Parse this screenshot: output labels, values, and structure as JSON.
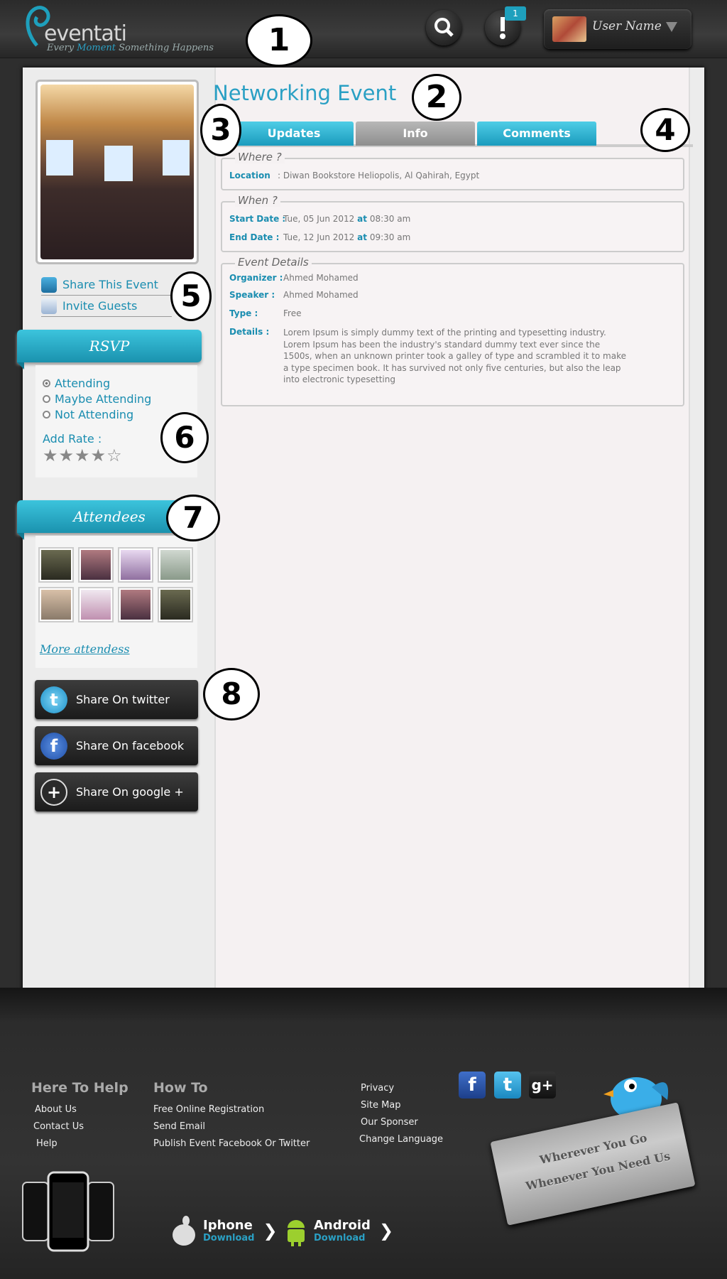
{
  "header": {
    "logo_word": "eventati",
    "tagline_pre": "Every",
    "tagline_hl": "Moment",
    "tagline_post": "Something Happens",
    "notification_count": "1",
    "user_name": "User Name"
  },
  "callouts": [
    "1",
    "2",
    "3",
    "4",
    "5",
    "6",
    "7",
    "8"
  ],
  "event": {
    "title": "Networking Event"
  },
  "tabs": [
    {
      "label": "Updates",
      "active": false
    },
    {
      "label": "Info",
      "active": true
    },
    {
      "label": "Comments",
      "active": false
    }
  ],
  "where": {
    "legend": "Where ?",
    "location_label": "Location",
    "location_value": ": Diwan Bookstore Heliopolis, Al Qahirah, Egypt"
  },
  "when": {
    "legend": "When ?",
    "start_label": "Start Date :",
    "start_date": "Tue, 05 Jun 2012",
    "start_at": "at",
    "start_time": "08:30 am",
    "end_label": "End Date :",
    "end_date": "Tue, 12 Jun 2012",
    "end_at": "at",
    "end_time": "09:30 am"
  },
  "details": {
    "legend": "Event Details",
    "organizer_label": "Organizer :",
    "organizer": "Ahmed Mohamed",
    "speaker_label": "Speaker :",
    "speaker": "Ahmed Mohamed",
    "type_label": "Type :",
    "type": "Free",
    "details_label": "Details :",
    "details_text": "Lorem Ipsum is simply dummy text of the printing and typesetting industry. Lorem Ipsum has been the industry's standard dummy text ever since the 1500s, when an unknown printer took a galley of type and scrambled it to make a type specimen book. It has survived not only five centuries, but also the leap into electronic typesetting"
  },
  "sidebar": {
    "share_event": "Share This Event",
    "invite_guests": "Invite Guests",
    "rsvp_title": "RSVP",
    "rsvp_options": [
      {
        "label": "Attending",
        "selected": true
      },
      {
        "label": "Maybe Attending",
        "selected": false
      },
      {
        "label": "Not Attending",
        "selected": false
      }
    ],
    "rate_label": "Add Rate :",
    "rating": 4,
    "rating_max": 5,
    "attendees_title": "Attendees",
    "more_attendees": "More attendess",
    "share_twitter": "Share On twitter",
    "share_facebook": "Share On facebook",
    "share_google": "Share On google +"
  },
  "footer": {
    "help_title": "Here To Help",
    "help_links": [
      "About Us",
      "Contact Us",
      "Help"
    ],
    "howto_title": "How To",
    "howto_links": [
      "Free Online Registration",
      "Send Email",
      "Publish Event Facebook Or Twitter"
    ],
    "misc_links": [
      "Privacy",
      "Site Map",
      "Our Sponser",
      "Change Language"
    ],
    "plaque_line1": "Wherever You Go",
    "plaque_line2": "Whenever You Need Us",
    "iphone_label": "Iphone",
    "iphone_download": "Download",
    "android_label": "Android",
    "android_download": "Download"
  },
  "colors": {
    "accent": "#2aa0c4",
    "tab": "#1a9bbd",
    "active_tab": "#9a9a9a"
  }
}
